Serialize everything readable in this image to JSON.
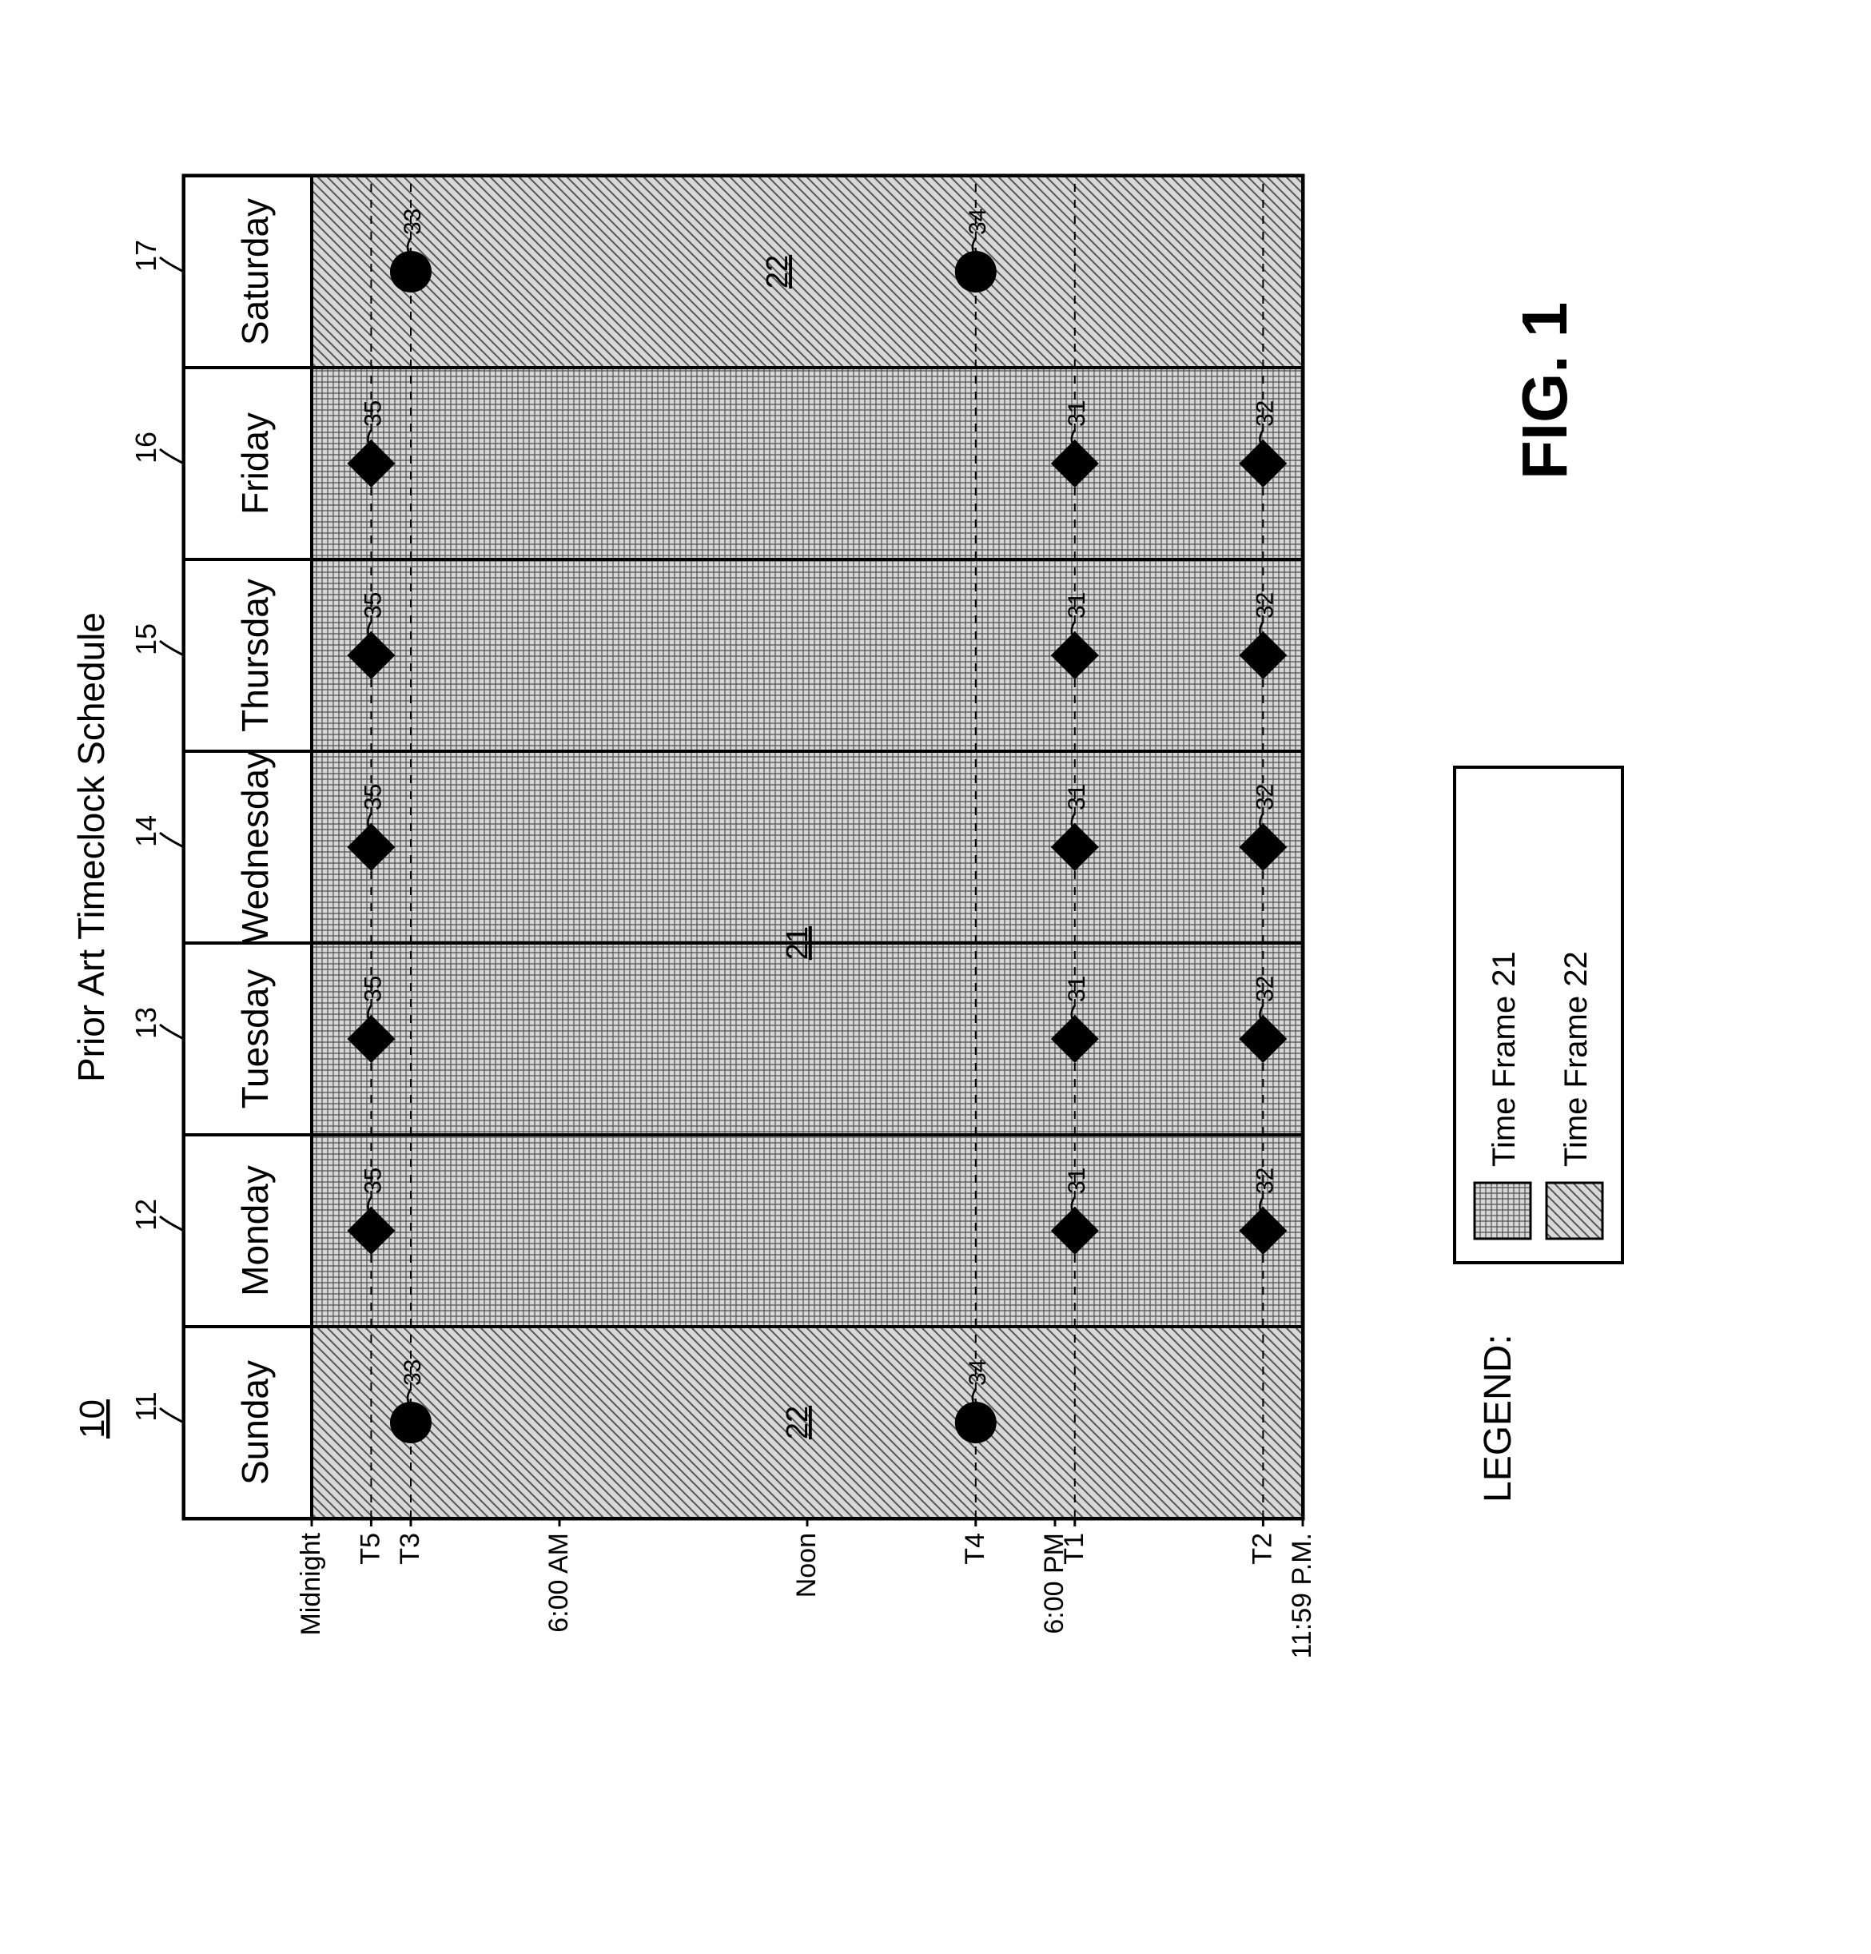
{
  "figure_label": "FIG. 1",
  "legend_label": "LEGEND:",
  "legend": {
    "tf21": "Time Frame 21",
    "tf22": "Time Frame 22"
  },
  "chart_data": {
    "type": "schedule",
    "title": "Prior Art Timeclock Schedule",
    "ref_num_overall": "10",
    "day_columns": [
      {
        "label": "Sunday",
        "ref": "11",
        "time_frame": "22",
        "markers": [
          "33",
          "34"
        ]
      },
      {
        "label": "Monday",
        "ref": "12",
        "time_frame": "21",
        "markers": [
          "35",
          "31",
          "32"
        ]
      },
      {
        "label": "Tuesday",
        "ref": "13",
        "time_frame": "21",
        "markers": [
          "35",
          "31",
          "32"
        ]
      },
      {
        "label": "Wednesday",
        "ref": "14",
        "time_frame": "21",
        "markers": [
          "35",
          "31",
          "32"
        ]
      },
      {
        "label": "Thursday",
        "ref": "15",
        "time_frame": "21",
        "markers": [
          "35",
          "31",
          "32"
        ]
      },
      {
        "label": "Friday",
        "ref": "16",
        "time_frame": "21",
        "markers": [
          "35",
          "31",
          "32"
        ]
      },
      {
        "label": "Saturday",
        "ref": "17",
        "time_frame": "22",
        "markers": [
          "33",
          "34"
        ]
      }
    ],
    "y_axis_ticks": [
      "Midnight",
      "T5",
      "T3",
      "6:00 AM",
      "Noon",
      "T4",
      "6:00 PM",
      "T1",
      "T2",
      "11:59 P.M."
    ],
    "marker_shapes": {
      "time_frame_21": "diamond",
      "time_frame_22": "circle"
    },
    "text_in_chart": [
      "21",
      "22"
    ],
    "marker_time_positions": {
      "33": "T3",
      "34": "T4",
      "35": "T5",
      "31": "T1",
      "32": "T2"
    }
  }
}
